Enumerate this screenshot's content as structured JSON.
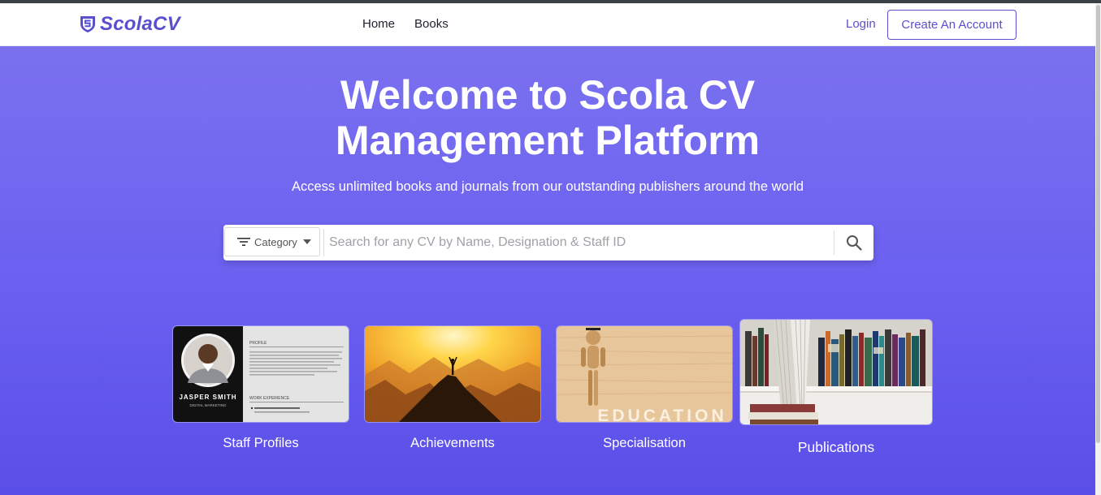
{
  "brand": {
    "name": "ScolaCV",
    "logo_icon": "shield-icon",
    "color": "#5a4fcf"
  },
  "nav": {
    "links": [
      "Home",
      "Books"
    ],
    "login": "Login",
    "create_account": "Create An Account"
  },
  "hero": {
    "title_line1": "Welcome to Scola CV",
    "title_line2": "Management Platform",
    "subtitle": "Access unlimited books and journals from our outstanding publishers around the world",
    "gradient_top": "#7a71ef",
    "gradient_bottom": "#5a4ee8"
  },
  "search": {
    "category_label": "Category",
    "placeholder": "Search for any CV by Name, Designation & Staff ID",
    "value": ""
  },
  "cards": [
    {
      "label": "Staff Profiles",
      "image": "resume-thumbnail",
      "resume_name": "JASPER SMITH",
      "resume_role": "DIGITAL MARKETING",
      "resume_section1": "PROFILE",
      "resume_section2": "WORK EXPERIENCE"
    },
    {
      "label": "Achievements",
      "image": "mountain-summit-photo"
    },
    {
      "label": "Specialisation",
      "image": "education-wooden-figure-photo",
      "image_text": "EDUCATION"
    },
    {
      "label": "Publications",
      "image": "bookshelf-photo"
    }
  ]
}
